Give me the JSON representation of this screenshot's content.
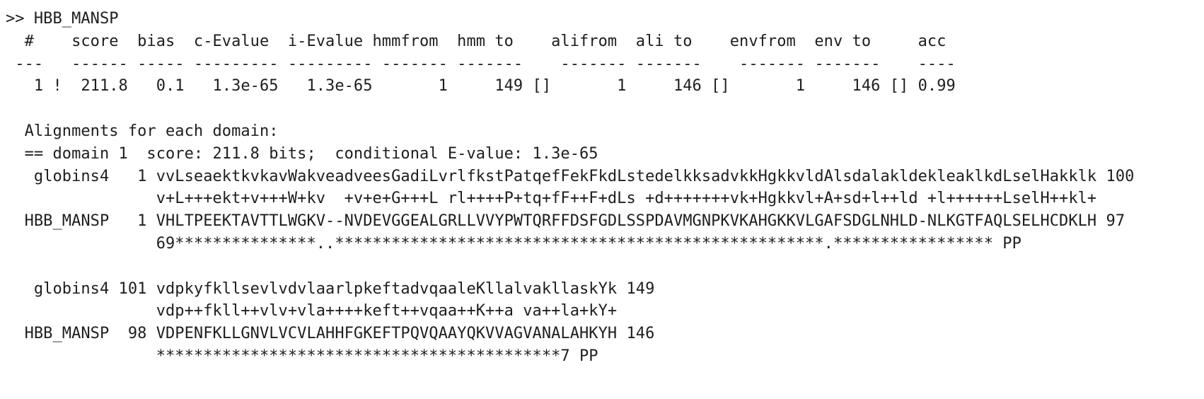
{
  "hit_header": ">> HBB_MANSP",
  "domain_table": {
    "header": "  #    score  bias  c-Evalue  i-Evalue hmmfrom  hmm to    alifrom  ali to    envfrom  env to     acc",
    "rule": " ---   ------ ----- --------- --------- ------- -------    ------- -------    ------- -------    ----",
    "rows": [
      "   1 !  211.8   0.1   1.3e-65   1.3e-65       1     149 []       1     146 []       1     146 [] 0.99"
    ]
  },
  "alignments_title": "  Alignments for each domain:",
  "domain_heading": "  == domain 1  score: 211.8 bits;  conditional E-value: 1.3e-65",
  "alignment_blocks": [
    {
      "model": "   globins4   1 vvLseaektkvkavWakveadveesGadiLvrlfkstPatqefFekFkdLstedelkksadvkkHgkkvldAlsdalakldekleaklkdLselHakklk 100",
      "match": "                v+L+++ekt+v+++W+kv  +v+e+G+++L rl++++P+tq+fF++F+dLs +d+++++++vk+Hgkkvl+A+sd+l++ld +l++++++LselH++kl+",
      "target": "  HBB_MANSP   1 VHLTPEEKTAVTTLWGKV--NVDEVGGEALGRLLVVYPWTQRFFDSFGDLSSPDAVMGNPKVKAHGKKVLGAFSDGLNHLD-NLKGTFAQLSELHCDKLH 97",
      "pp": "                69***************..****************************************************.***************** PP"
    },
    {
      "model": "   globins4 101 vdpkyfkllsevlvdvlaarlpkeftadvqaaleKllalvakllaskYk 149",
      "match": "                vdp++fkll++vlv+vla++++keft++vqaa++K++a va++la+kY+",
      "target": "  HBB_MANSP  98 VDPENFKLLGNVLVCVLAHHFGKEFTPQVQAAYQKVVAGVANALAHKYH 146",
      "pp": "                *******************************************7 PP"
    }
  ]
}
